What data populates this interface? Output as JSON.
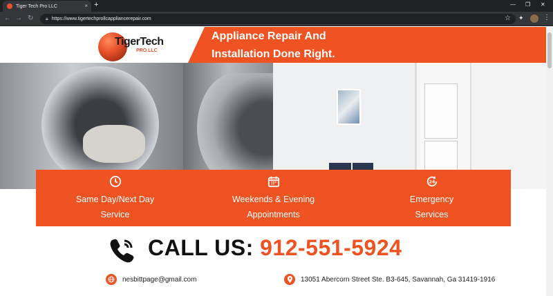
{
  "browser": {
    "tab_title": "Tiger Tech Pro LLC",
    "url": "https://www.tigertechprollcappliancerepair.com",
    "new_tab": "+",
    "close_tab": "×"
  },
  "logo": {
    "name": "TigerTech",
    "sub": "PRO LLC"
  },
  "banner": {
    "line1": "Appliance Repair And",
    "line2": "Installation Done Right."
  },
  "features": [
    {
      "icon": "clock-icon",
      "line1": "Same Day/Next Day",
      "line2": "Service"
    },
    {
      "icon": "calendar-icon",
      "line1": "Weekends & Evening",
      "line2": "Appointments"
    },
    {
      "icon": "24-hour-icon",
      "line1": "Emergency",
      "line2": "Services"
    }
  ],
  "call": {
    "label": "CALL US:",
    "number": "912-551-5924"
  },
  "contact": {
    "email": "nesbittpage@gmail.com",
    "address": "13051 Abercorn Street Ste. B3-645, Savannah, Ga 31419-1916"
  },
  "colors": {
    "accent": "#f05322",
    "chrome_dark": "#202124",
    "chrome_mid": "#35363a"
  }
}
